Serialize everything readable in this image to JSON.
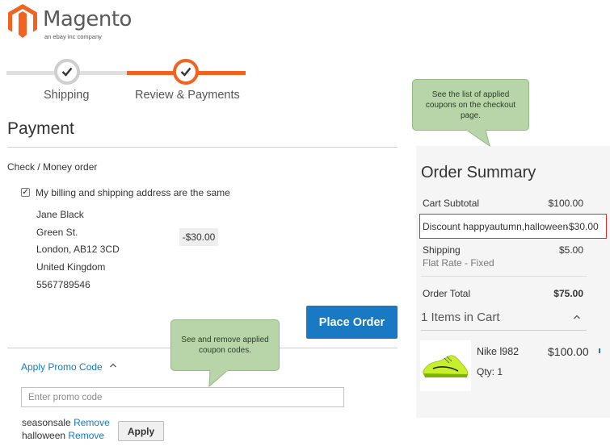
{
  "logo": {
    "name": "Magento",
    "tagline": "an ebay inc company",
    "brand_color": "#f26322"
  },
  "progress": {
    "steps": [
      {
        "label": "Shipping",
        "state": "completed"
      },
      {
        "label": "Review & Payments",
        "state": "active"
      }
    ],
    "active_color": "#f26322",
    "inactive_color": "#e0e0e0"
  },
  "payment": {
    "title": "Payment",
    "method": "Check / Money order",
    "same_address_label": "My billing and shipping address are the same",
    "same_address_checked": true,
    "address": [
      "Jane Black",
      "Green St.",
      "London, AB12 3CD",
      "United Kingdom",
      "5567789546"
    ],
    "discount_display": "-$30.00",
    "place_order_label": "Place Order"
  },
  "promo": {
    "toggle_label": "Apply Promo Code",
    "input_placeholder": "Enter promo code",
    "input_value": "",
    "coupons": [
      {
        "code": "seasonsale",
        "remove_label": "Remove"
      },
      {
        "code": "halloween",
        "remove_label": "Remove"
      }
    ],
    "apply_label": "Apply"
  },
  "callouts": {
    "summary_note": "See the list of applied coupons on the checkout page.",
    "promo_note": "See and remove applied coupon codes."
  },
  "summary": {
    "title": "Order Summary",
    "cart_subtotal_label": "Cart Subtotal",
    "cart_subtotal_value": "$100.00",
    "discount_label": "Discount happyautumn,halloween",
    "discount_value": "-$30.00",
    "shipping_label": "Shipping",
    "shipping_method": "Flat Rate - Fixed",
    "shipping_value": "$5.00",
    "order_total_label": "Order Total",
    "order_total_value": "$75.00",
    "items_in_cart_label": "1 Items in Cart",
    "items": [
      {
        "name": "Nike l982",
        "qty_label": "Qty: 1",
        "price": "$100.00",
        "image_icon": "yellow-sneaker"
      }
    ]
  }
}
